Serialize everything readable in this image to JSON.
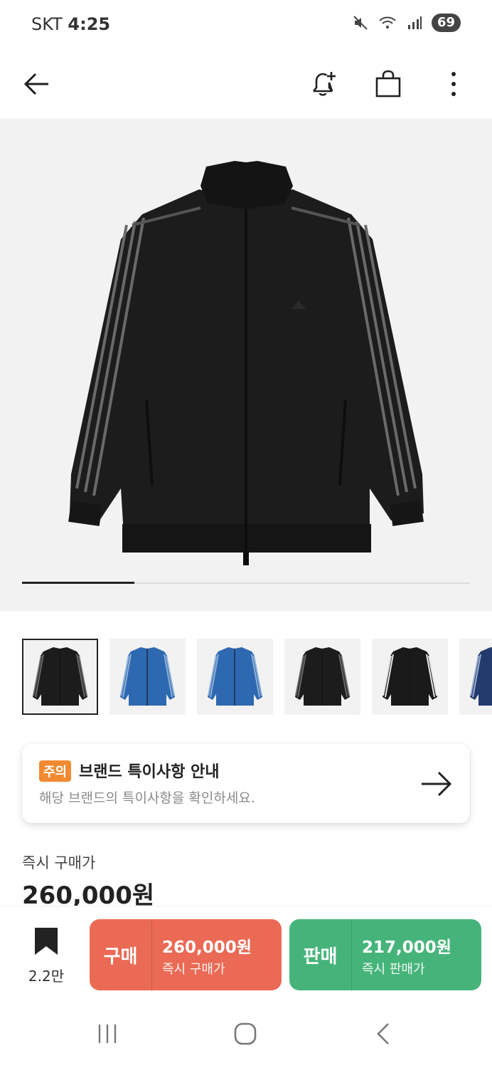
{
  "status_bar": {
    "carrier": "SKT",
    "time": "4:25",
    "battery": "69",
    "icons": [
      "mute-icon",
      "wifi-icon",
      "signal-icon"
    ]
  },
  "app_bar": {
    "icons": [
      "back-arrow-icon",
      "bell-plus-icon",
      "shopping-bag-icon",
      "more-vertical-icon"
    ]
  },
  "gallery": {
    "progress": 0.25,
    "thumbnails": [
      {
        "colorway": "black",
        "selected": true
      },
      {
        "colorway": "blue",
        "selected": false
      },
      {
        "colorway": "blue",
        "selected": false
      },
      {
        "colorway": "black",
        "selected": false
      },
      {
        "colorway": "black-white-stripes",
        "selected": false
      },
      {
        "colorway": "navy",
        "selected": false
      }
    ]
  },
  "notice": {
    "badge": "주의",
    "title": "브랜드 특이사항 안내",
    "subtitle": "해당 브랜드의 특이사항을 확인하세요."
  },
  "price": {
    "label": "즉시 구매가",
    "value": "260,000원"
  },
  "actions": {
    "bookmark_count": "2.2만",
    "buy": {
      "kind": "구매",
      "amount": "260,000원",
      "sub": "즉시 구매가"
    },
    "sell": {
      "kind": "판매",
      "amount": "217,000원",
      "sub": "즉시 판매가"
    }
  },
  "colors": {
    "buy": "#ea6a55",
    "sell": "#46b47a",
    "badge": "#f18a31"
  }
}
